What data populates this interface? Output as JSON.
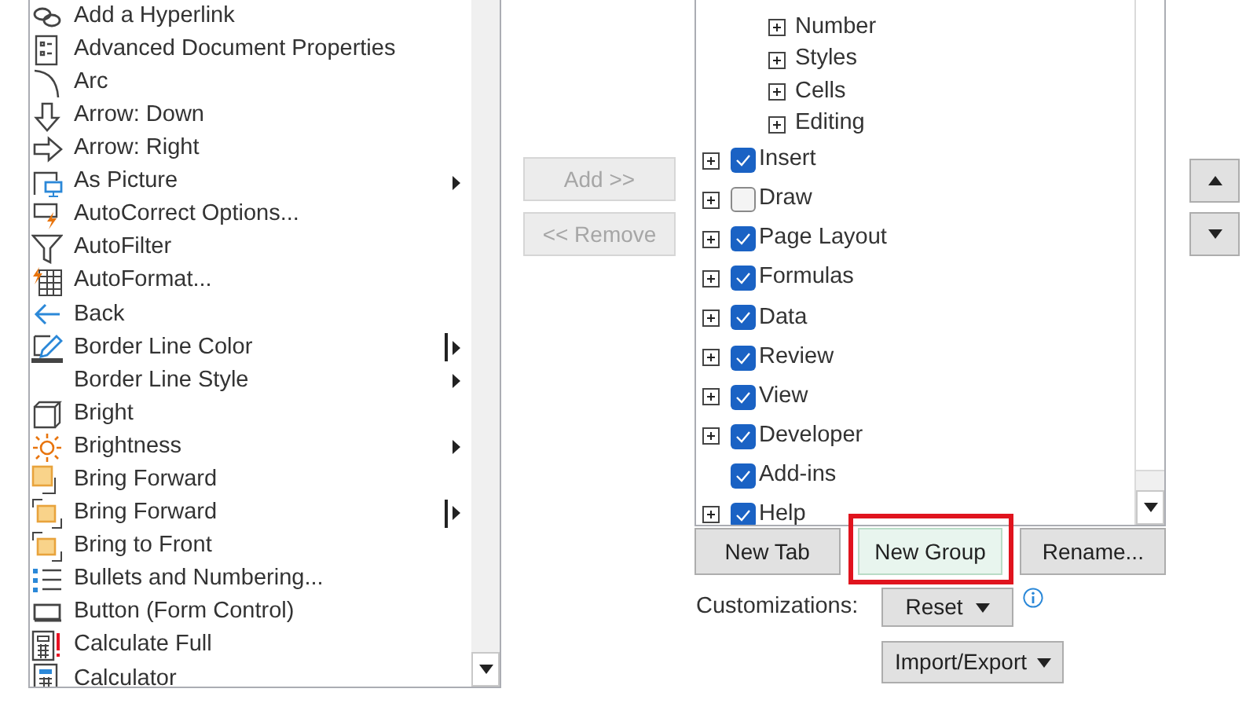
{
  "commands": [
    {
      "label": "Add a Hyperlink",
      "submenu": false,
      "split": false
    },
    {
      "label": "Advanced Document Properties",
      "submenu": false,
      "split": false
    },
    {
      "label": "Arc",
      "submenu": false,
      "split": false
    },
    {
      "label": "Arrow: Down",
      "submenu": false,
      "split": false
    },
    {
      "label": "Arrow: Right",
      "submenu": false,
      "split": false
    },
    {
      "label": "As Picture",
      "submenu": true,
      "split": false
    },
    {
      "label": "AutoCorrect Options...",
      "submenu": false,
      "split": false
    },
    {
      "label": "AutoFilter",
      "submenu": false,
      "split": false
    },
    {
      "label": "AutoFormat...",
      "submenu": false,
      "split": false
    },
    {
      "label": "Back",
      "submenu": false,
      "split": false
    },
    {
      "label": "Border Line Color",
      "submenu": true,
      "split": true
    },
    {
      "label": "Border Line Style",
      "submenu": true,
      "split": false
    },
    {
      "label": "Bright",
      "submenu": false,
      "split": false
    },
    {
      "label": "Brightness",
      "submenu": true,
      "split": false
    },
    {
      "label": "Bring Forward",
      "submenu": false,
      "split": false
    },
    {
      "label": "Bring Forward",
      "submenu": true,
      "split": true
    },
    {
      "label": "Bring to Front",
      "submenu": false,
      "split": false
    },
    {
      "label": "Bullets and Numbering...",
      "submenu": false,
      "split": false
    },
    {
      "label": "Button (Form Control)",
      "submenu": false,
      "split": false
    },
    {
      "label": "Calculate Full",
      "submenu": false,
      "split": false
    },
    {
      "label": "Calculator",
      "submenu": false,
      "split": false
    }
  ],
  "transfer_buttons": [
    {
      "label": "Add >>",
      "disabled": true
    },
    {
      "label": "<< Remove",
      "disabled": true
    }
  ],
  "tree": {
    "groups": [
      {
        "label": "Number",
        "expandable": true
      },
      {
        "label": "Styles",
        "expandable": true
      },
      {
        "label": "Cells",
        "expandable": true
      },
      {
        "label": "Editing",
        "expandable": true
      }
    ],
    "tabs": [
      {
        "label": "Insert",
        "expandable": true,
        "checked": true
      },
      {
        "label": "Draw",
        "expandable": true,
        "checked": false
      },
      {
        "label": "Page Layout",
        "expandable": true,
        "checked": true
      },
      {
        "label": "Formulas",
        "expandable": true,
        "checked": true
      },
      {
        "label": "Data",
        "expandable": true,
        "checked": true
      },
      {
        "label": "Review",
        "expandable": true,
        "checked": true
      },
      {
        "label": "View",
        "expandable": true,
        "checked": true
      },
      {
        "label": "Developer",
        "expandable": true,
        "checked": true
      },
      {
        "label": "Add-ins",
        "expandable": false,
        "checked": true
      },
      {
        "label": "Help",
        "expandable": true,
        "checked": true
      }
    ]
  },
  "tree_buttons": [
    {
      "label": "New Tab",
      "highlighted": false
    },
    {
      "label": "New Group",
      "highlighted": true
    },
    {
      "label": "Rename...",
      "highlighted": false
    }
  ],
  "customizations": {
    "label": "Customizations:",
    "reset": "Reset",
    "import_export": "Import/Export"
  }
}
